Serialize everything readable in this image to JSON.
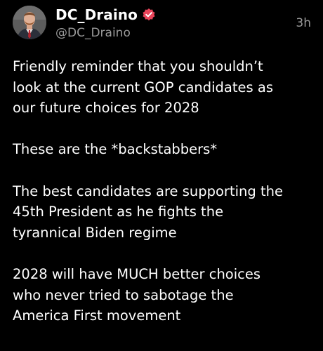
{
  "post": {
    "author": {
      "display_name": "DC_Draino",
      "handle": "@DC_Draino",
      "verified": true,
      "verified_badge_color": "#e8445a",
      "avatar_icon": "profile-photo"
    },
    "timestamp": "3h",
    "paragraphs": [
      {
        "lines": [
          "Friendly reminder that you shouldn’t",
          "look at the current GOP candidates as",
          "our future choices for 2028"
        ]
      },
      {
        "lines": [
          "These are the *backstabbers*"
        ]
      },
      {
        "lines": [
          "The best candidates are supporting the",
          "45th President as he fights the",
          "tyrannical Biden regime"
        ]
      },
      {
        "lines": [
          "2028 will have MUCH better choices",
          "who never tried to sabotage the",
          "America First movement"
        ]
      }
    ]
  },
  "colors": {
    "background": "#000000",
    "text": "#ffffff",
    "secondary_text": "#9a9a9a"
  }
}
